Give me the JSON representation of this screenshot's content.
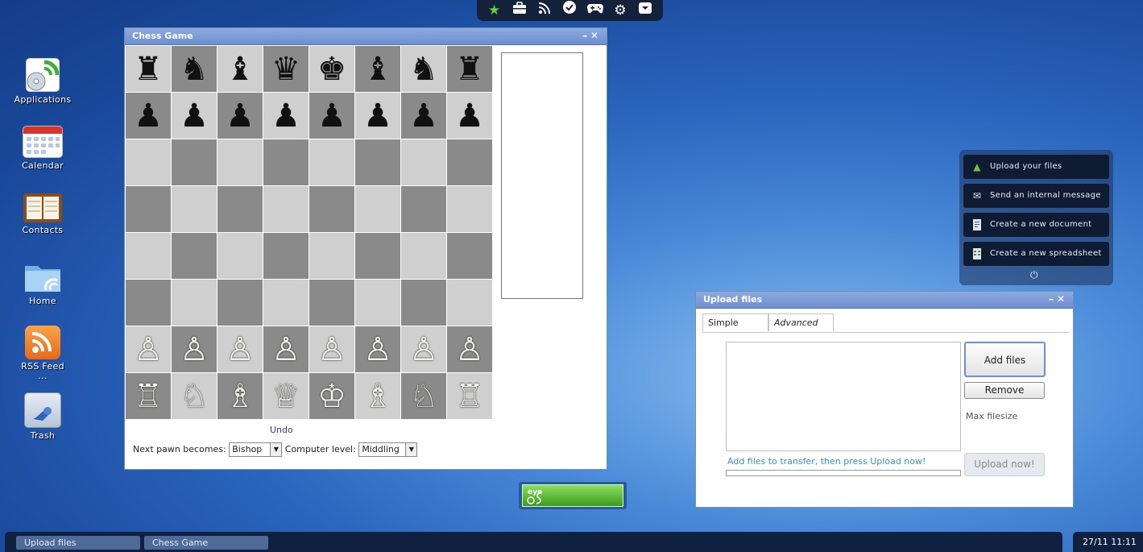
{
  "topbar": {
    "icons": [
      "star-icon",
      "briefcase-icon",
      "rss-icon",
      "check-icon",
      "gamepad-icon",
      "gear-icon",
      "dropdown-icon"
    ]
  },
  "desktop": {
    "icons": [
      {
        "label": "Applications"
      },
      {
        "label": "Calendar"
      },
      {
        "label": "Contacts"
      },
      {
        "label": "Home"
      },
      {
        "label": "RSS Feed ..."
      },
      {
        "label": "Trash"
      }
    ]
  },
  "chess": {
    "title": "Chess Game",
    "board": [
      [
        "♜",
        "♞",
        "♝",
        "♛",
        "♚",
        "♝",
        "♞",
        "♜"
      ],
      [
        "♟",
        "♟",
        "♟",
        "♟",
        "♟",
        "♟",
        "♟",
        "♟"
      ],
      [
        "",
        "",
        "",
        "",
        "",
        "",
        "",
        ""
      ],
      [
        "",
        "",
        "",
        "",
        "",
        "",
        "",
        ""
      ],
      [
        "",
        "",
        "",
        "",
        "",
        "",
        "",
        ""
      ],
      [
        "",
        "",
        "",
        "",
        "",
        "",
        "",
        ""
      ],
      [
        "♙",
        "♙",
        "♙",
        "♙",
        "♙",
        "♙",
        "♙",
        "♙"
      ],
      [
        "♖",
        "♘",
        "♗",
        "♕",
        "♔",
        "♗",
        "♘",
        "♖"
      ]
    ],
    "undo_label": "Undo",
    "pawn_label": "Next pawn becomes:",
    "pawn_value": "Bishop",
    "level_label": "Computer level:",
    "level_value": "Middling"
  },
  "quick_actions": {
    "items": [
      {
        "label": "Upload your files",
        "icon": "upload-arrow-icon"
      },
      {
        "label": "Send an internal message",
        "icon": "envelope-icon"
      },
      {
        "label": "Create a new document",
        "icon": "document-icon"
      },
      {
        "label": "Create a new spreadsheet",
        "icon": "spreadsheet-icon"
      }
    ],
    "power_icon": "power-icon"
  },
  "upload": {
    "title": "Upload files",
    "tabs": [
      {
        "label": "Simple"
      },
      {
        "label": "Advanced"
      }
    ],
    "add_label": "Add files",
    "remove_label": "Remove",
    "max_label": "Max filesize",
    "hint": "Add files to transfer, then press Upload now!",
    "upload_label": "Upload now!"
  },
  "taskbar": {
    "tasks": [
      {
        "label": "Upload files"
      },
      {
        "label": "Chess Game"
      }
    ],
    "clock": "27/11 11:11"
  },
  "colors": {
    "accent": "#6e8fcf",
    "link": "#3a8fc8",
    "green": "#6fc23a"
  }
}
